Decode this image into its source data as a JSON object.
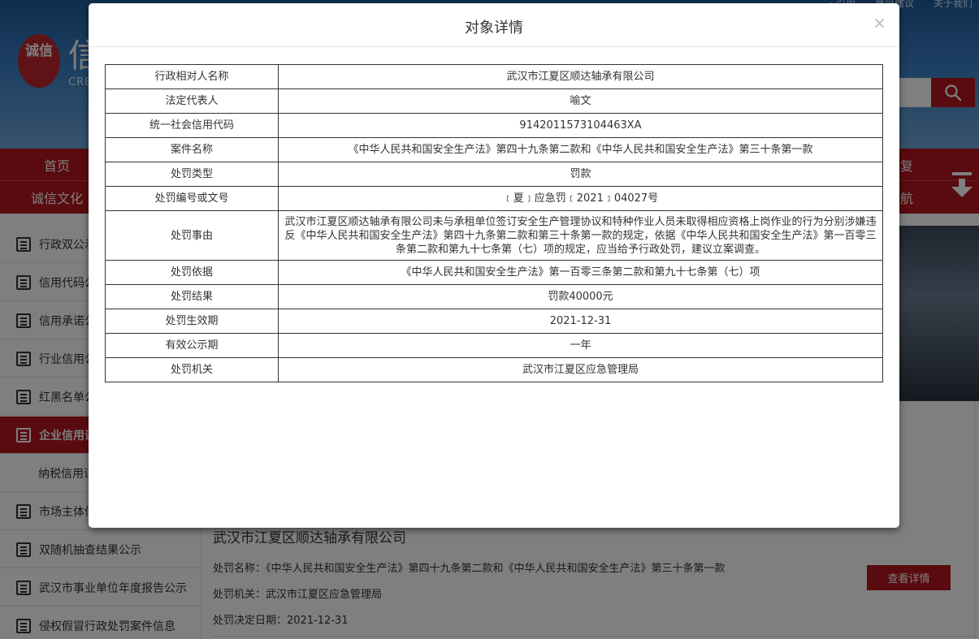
{
  "background": {
    "logo": {
      "seal": "诚信",
      "title": "信",
      "subtitle": "CRE"
    },
    "toplinks": [
      "· 引用",
      "意见建议",
      "关于我们"
    ],
    "nav": {
      "row1_left": "首页",
      "row1_right": "复",
      "row2_left": "诚信文化",
      "row2_right": "航"
    },
    "sidebar": [
      {
        "label": "行政双公示",
        "active": false,
        "sub": false
      },
      {
        "label": "信用代码公示",
        "active": false,
        "sub": false
      },
      {
        "label": "信用承诺公示",
        "active": false,
        "sub": false
      },
      {
        "label": "行业信用公示",
        "active": false,
        "sub": false
      },
      {
        "label": "红黑名单公示",
        "active": false,
        "sub": false
      },
      {
        "label": "企业信用评价",
        "active": true,
        "sub": false
      },
      {
        "label": "纳税信用评价",
        "active": false,
        "sub": true
      },
      {
        "label": "市场主体信息",
        "active": false,
        "sub": false
      },
      {
        "label": "双随机抽查结果公示",
        "active": false,
        "sub": false
      },
      {
        "label": "武汉市事业单位年度报告公示",
        "active": false,
        "sub": false
      },
      {
        "label": "侵权假冒行政处罚案件信息",
        "active": false,
        "sub": false
      }
    ],
    "result": {
      "title": "武汉市江夏区顺达轴承有限公司",
      "case_name_line": "处罚名称：《中华人民共和国安全生产法》第四十九条第二款和《中华人民共和国安全生产法》第三十条第一款",
      "authority_line": "处罚机关：武汉市江夏区应急管理局",
      "date_line": "处罚决定日期：2021-12-31",
      "detail_button": "查看详情"
    }
  },
  "modal": {
    "title": "对象详情",
    "close": "×",
    "rows": [
      {
        "label": "行政相对人名称",
        "value": "武汉市江夏区顺达轴承有限公司"
      },
      {
        "label": "法定代表人",
        "value": "喻文"
      },
      {
        "label": "统一社会信用代码",
        "value": "9142011573104463XA"
      },
      {
        "label": "案件名称",
        "value": "《中华人民共和国安全生产法》第四十九条第二款和《中华人民共和国安全生产法》第三十条第一款"
      },
      {
        "label": "处罚类型",
        "value": "罚款"
      },
      {
        "label": "处罚编号或文号",
        "value": "﹝夏﹞应急罚﹝2021﹞04027号"
      },
      {
        "label": "处罚事由",
        "value": "武汉市江夏区顺达轴承有限公司未与承租单位签订安全生产管理协议和特种作业人员未取得相应资格上岗作业的行为分别涉嫌违反《中华人民共和国安全生产法》第四十九条第二款和第三十条第一款的规定，依据《中华人民共和国安全生产法》第一百零三条第二款和第九十七条第（七）项的规定，应当给予行政处罚，建议立案调查。"
      },
      {
        "label": "处罚依据",
        "value": "《中华人民共和国安全生产法》第一百零三条第二款和第九十七条第（七）项"
      },
      {
        "label": "处罚结果",
        "value": "罚款40000元"
      },
      {
        "label": "处罚生效期",
        "value": "2021-12-31"
      },
      {
        "label": "有效公示期",
        "value": "一年"
      },
      {
        "label": "处罚机关",
        "value": "武汉市江夏区应急管理局"
      }
    ]
  }
}
